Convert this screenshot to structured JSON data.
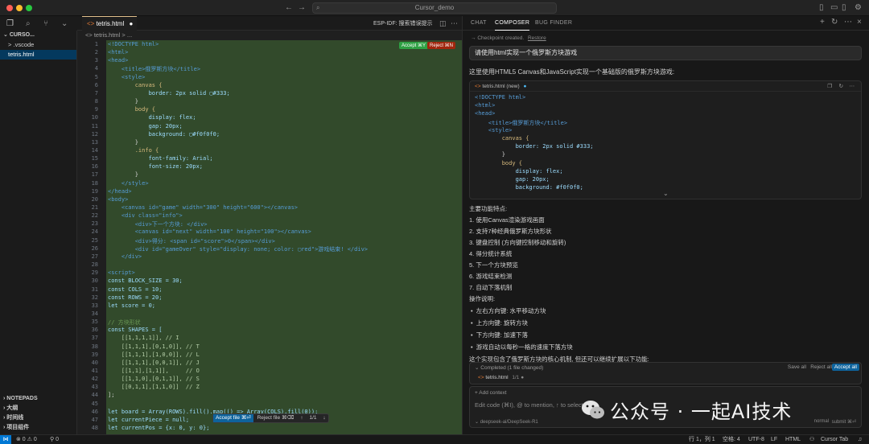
{
  "window": {
    "title": "Cursor_demo"
  },
  "sidebar": {
    "header": "CURSO...",
    "items": [
      {
        "label": ".vscode",
        "chevron": ">"
      },
      {
        "label": "tetris.html"
      }
    ],
    "bottom_sections": [
      "NOTEPADS",
      "大纲",
      "时间线",
      "项目组件"
    ]
  },
  "editor": {
    "tab_label": "tetris.html",
    "breadcrumb": "<> tetris.html > ...",
    "toolbar_right": "ESP-IDF: 搜索错误提示",
    "accept_label": "Accept ⌘Y",
    "reject_label": "Reject ⌘N",
    "diff_toolbar": {
      "accept": "Accept file ⌘⏎",
      "reject": "Reject file ⌘⌫",
      "counter": "1/1"
    },
    "line_numbers": [
      "1",
      "2",
      "3",
      "4",
      "5",
      "6",
      "7",
      "8",
      "9",
      "10",
      "11",
      "12",
      "13",
      "14",
      "15",
      "16",
      "17",
      "18",
      "19",
      "20",
      "21",
      "22",
      "23",
      "24",
      "25",
      "26",
      "27",
      "28",
      "29",
      "30",
      "31",
      "32",
      "33",
      "34",
      "35",
      "36",
      "37",
      "38",
      "39",
      "40",
      "41",
      "42",
      "43",
      "44",
      "45",
      "46",
      "47",
      "48"
    ],
    "code_lines": [
      "<!DOCTYPE html>",
      "<html>",
      "<head>",
      "    <title>俄罗斯方块</title>",
      "    <style>",
      "        canvas {",
      "            border: 2px solid ▢#333;",
      "        }",
      "        body {",
      "            display: flex;",
      "            gap: 20px;",
      "            background: ▢#f0f0f0;",
      "        }",
      "        .info {",
      "            font-family: Arial;",
      "            font-size: 20px;",
      "        }",
      "    </style>",
      "</head>",
      "<body>",
      "    <canvas id=\"game\" width=\"300\" height=\"600\"></canvas>",
      "    <div class=\"info\">",
      "        <div>下一个方块: </div>",
      "        <canvas id=\"next\" width=\"100\" height=\"100\"></canvas>",
      "        <div>得分: <span id=\"score\">0</span></div>",
      "        <div id=\"gameOver\" style=\"display: none; color: ▢red\">游戏结束! </div>",
      "    </div>",
      "",
      "<script>",
      "const BLOCK_SIZE = 30;",
      "const COLS = 10;",
      "const ROWS = 20;",
      "let score = 0;",
      "",
      "// 方块形状",
      "const SHAPES = [",
      "    [[1,1,1,1]], // I",
      "    [[1,1,1],[0,1,0]], // T",
      "    [[1,1,1],[1,0,0]], // L",
      "    [[1,1,1],[0,0,1]], // J",
      "    [[1,1],[1,1]],     // O",
      "    [[1,1,0],[0,1,1]], // S",
      "    [[0,1,1],[1,1,0]]  // Z",
      "];",
      "",
      "let board = Array(ROWS).fill().map(() => Array(COLS).fill(0));",
      "let currentPiece = null;",
      "let currentPos = {x: 0, y: 0};"
    ]
  },
  "panel": {
    "tabs": [
      "CHAT",
      "COMPOSER",
      "BUG FINDER"
    ],
    "checkpoint": "Checkpoint created.",
    "restore": "Restore",
    "user_message": "请使用html实现一个俄罗斯方块游戏",
    "intro": "这里使用HTML5 Canvas和JavaScript实现一个基础版的俄罗斯方块游戏:",
    "codeblock_title": "tetris.html (new)",
    "codeblock_lines": [
      "<!DOCTYPE html>",
      "<html>",
      "<head>",
      "    <title>俄罗斯方块</title>",
      "    <style>",
      "        canvas {",
      "            border: 2px solid #333;",
      "        }",
      "        body {",
      "            display: flex;",
      "            gap: 20px;",
      "            background: #f0f0f0;"
    ],
    "features_title": "主要功能特点:",
    "features": [
      "1. 使用Canvas渲染游戏画面",
      "2. 支持7种经典俄罗斯方块形状",
      "3. 键盘控制 (方向键控制移动和旋转)",
      "4. 得分统计系统",
      "5. 下一个方块预览",
      "6. 游戏结束检测",
      "7. 自动下落机制"
    ],
    "controls_title": "操作说明:",
    "controls": [
      "左右方向键: 水平移动方块",
      "上方向键: 旋转方块",
      "下方向键: 加速下落",
      "游戏自动以每秒一格的速度下落方块"
    ],
    "summary": "这个实现包含了俄罗斯方块的核心机制, 但还可以继续扩展以下功能:",
    "completed": {
      "label": "Completed (1 file changed)",
      "save_all": "Save all",
      "reject_all": "Reject all",
      "accept_all": "Accept all",
      "file": "tetris.html",
      "file_meta": "1/1 ●"
    },
    "composer": {
      "add_context": "+ Add context",
      "placeholder": "Edit code (⌘I), @ to mention, ↑ to select",
      "model": "deepseek-ai/DeepSeek-R1",
      "mode": "normal",
      "submit": "submit ⌘⏎"
    }
  },
  "statusbar": {
    "errors": "⊗ 0 ⚠ 0",
    "ports": "⚲ 0",
    "position": "行 1，列 1",
    "spaces": "空格: 4",
    "encoding": "UTF-8",
    "eol": "LF",
    "language": "HTML",
    "cursor_tab": "Cursor Tab"
  },
  "watermark": {
    "text": "公众号 · 一起AI技术"
  }
}
